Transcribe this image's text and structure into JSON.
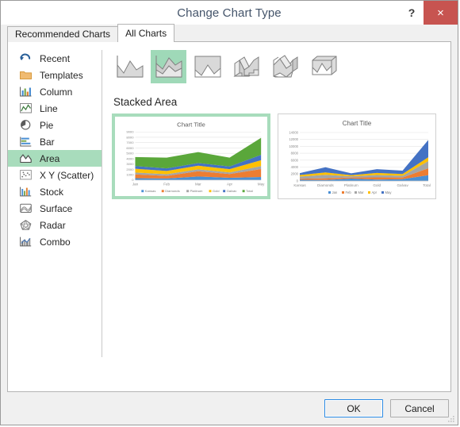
{
  "window": {
    "title": "Change Chart Type",
    "help_label": "?",
    "close_label": "×",
    "close_color": "#c75450",
    "title_color": "#44546a"
  },
  "tabs": [
    {
      "label": "Recommended Charts",
      "active": false
    },
    {
      "label": "All Charts",
      "active": true
    }
  ],
  "sidebar": {
    "selected_color": "#a8dcbc",
    "items": [
      {
        "label": "Recent",
        "icon": "recent-icon",
        "selected": false
      },
      {
        "label": "Templates",
        "icon": "folder-icon",
        "selected": false
      },
      {
        "label": "Column",
        "icon": "column-icon",
        "selected": false
      },
      {
        "label": "Line",
        "icon": "line-icon",
        "selected": false
      },
      {
        "label": "Pie",
        "icon": "pie-icon",
        "selected": false
      },
      {
        "label": "Bar",
        "icon": "bar-icon",
        "selected": false
      },
      {
        "label": "Area",
        "icon": "area-icon",
        "selected": true
      },
      {
        "label": "X Y (Scatter)",
        "icon": "scatter-icon",
        "selected": false
      },
      {
        "label": "Stock",
        "icon": "stock-icon",
        "selected": false
      },
      {
        "label": "Surface",
        "icon": "surface-icon",
        "selected": false
      },
      {
        "label": "Radar",
        "icon": "radar-icon",
        "selected": false
      },
      {
        "label": "Combo",
        "icon": "combo-icon",
        "selected": false
      }
    ]
  },
  "subtypes": {
    "selected_color": "#9fd9b8",
    "items": [
      {
        "name": "area",
        "selected": false
      },
      {
        "name": "stacked-area",
        "selected": true
      },
      {
        "name": "100-percent-stacked-area",
        "selected": false
      },
      {
        "name": "3d-area",
        "selected": false
      },
      {
        "name": "3d-stacked-area",
        "selected": false
      },
      {
        "name": "3d-100-percent-stacked-area",
        "selected": false
      }
    ]
  },
  "section": {
    "title": "Stacked Area"
  },
  "previews": [
    {
      "name": "preview-chart-by-month",
      "selected": true
    },
    {
      "name": "preview-chart-by-category",
      "selected": false
    }
  ],
  "footer": {
    "ok_label": "OK",
    "cancel_label": "Cancel"
  },
  "chart_data": [
    {
      "type": "area",
      "stacked": true,
      "title": "Chart Title",
      "xlabel": "",
      "ylabel": "",
      "categories": [
        "Jan",
        "Feb",
        "Mar",
        "Apr",
        "May"
      ],
      "ylim": [
        0,
        9000
      ],
      "yticks": [
        0,
        1000,
        2000,
        3000,
        4000,
        5000,
        6000,
        7000,
        8000,
        9000
      ],
      "grid": true,
      "legend_position": "bottom",
      "series": [
        {
          "name": "Kansas",
          "color": "#4a8fd4",
          "values": [
            350,
            300,
            650,
            420,
            560
          ]
        },
        {
          "name": "Diamonds",
          "color": "#ed7d31",
          "values": [
            700,
            480,
            980,
            700,
            1500
          ]
        },
        {
          "name": "Platinum",
          "color": "#a5a5a5",
          "values": [
            350,
            320,
            350,
            320,
            540
          ]
        },
        {
          "name": "Gold",
          "color": "#ffc000",
          "values": [
            700,
            620,
            680,
            600,
            1100
          ]
        },
        {
          "name": "Galvav",
          "color": "#4472c4",
          "values": [
            520,
            480,
            480,
            500,
            1000
          ]
        },
        {
          "name": "Total",
          "color": "#5aa73a",
          "values": [
            1680,
            2000,
            2060,
            1660,
            3200
          ]
        }
      ]
    },
    {
      "type": "area",
      "stacked": true,
      "title": "Chart Title",
      "xlabel": "",
      "ylabel": "",
      "categories": [
        "Kansas",
        "Diamonds",
        "Platinum",
        "Gold",
        "Galvav",
        "Total"
      ],
      "ylim": [
        0,
        14000
      ],
      "yticks": [
        0,
        2000,
        4000,
        6000,
        8000,
        10000,
        12000,
        14000
      ],
      "grid": true,
      "legend_position": "bottom",
      "series": [
        {
          "name": "Jan",
          "color": "#4a8fd4",
          "values": [
            350,
            700,
            350,
            700,
            520,
            1680
          ]
        },
        {
          "name": "Feb",
          "color": "#ed7d31",
          "values": [
            300,
            480,
            320,
            620,
            480,
            2000
          ]
        },
        {
          "name": "Mar",
          "color": "#a5a5a5",
          "values": [
            650,
            980,
            350,
            680,
            480,
            2060
          ]
        },
        {
          "name": "Apr",
          "color": "#ffc000",
          "values": [
            420,
            700,
            320,
            600,
            500,
            1660
          ]
        },
        {
          "name": "May",
          "color": "#4472c4",
          "values": [
            560,
            1500,
            540,
            1100,
            1000,
            5000
          ]
        }
      ]
    }
  ]
}
